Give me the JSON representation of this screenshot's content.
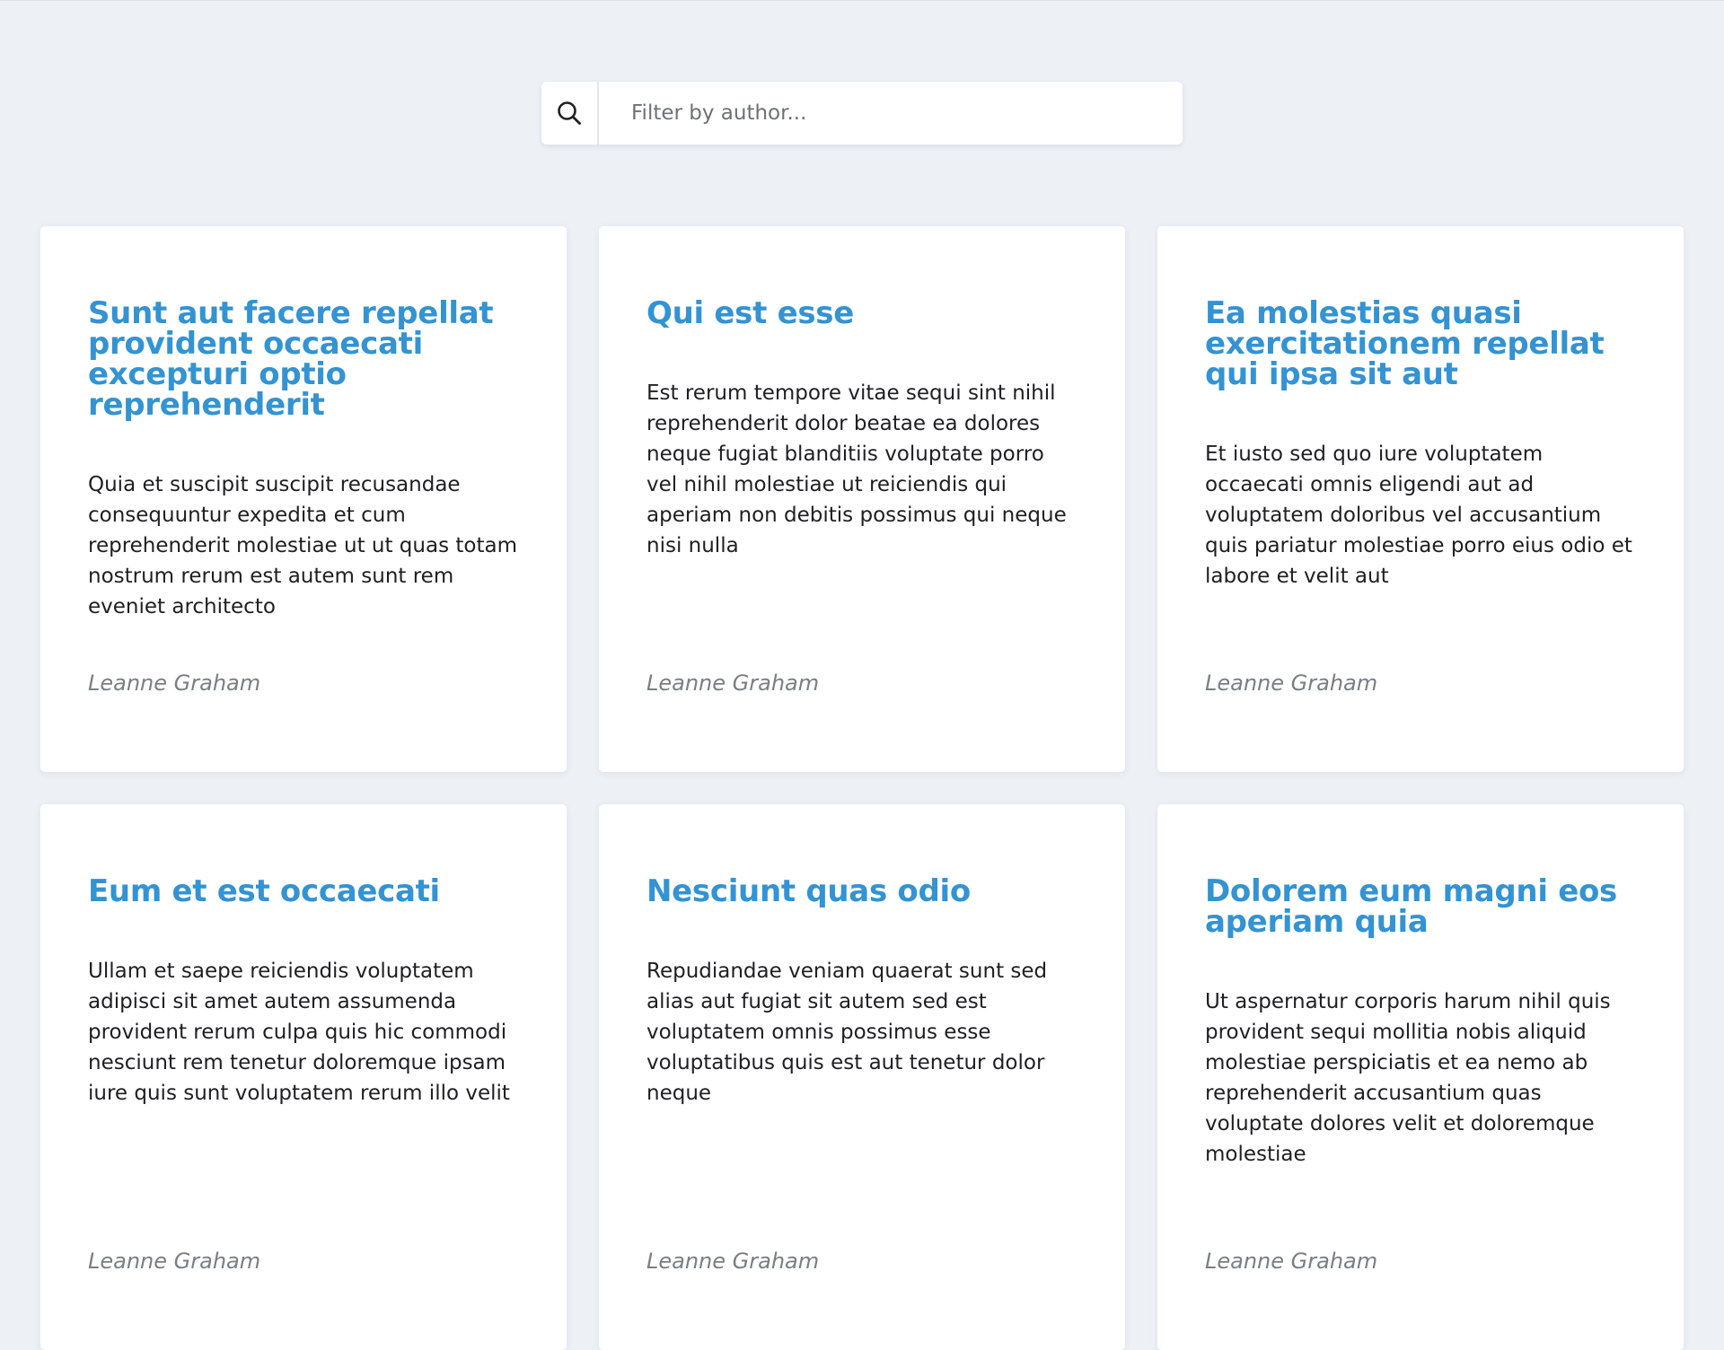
{
  "search": {
    "placeholder": "Filter by author...",
    "value": ""
  },
  "posts": [
    {
      "title": "Sunt aut facere repellat provident occaecati excepturi optio reprehenderit",
      "body": "Quia et suscipit suscipit recusandae consequuntur expedita et cum reprehenderit molestiae ut ut quas totam nostrum rerum est autem sunt rem eveniet architecto",
      "author": "Leanne Graham"
    },
    {
      "title": "Qui est esse",
      "body": "Est rerum tempore vitae sequi sint nihil reprehenderit dolor beatae ea dolores neque fugiat blanditiis voluptate porro vel nihil molestiae ut reiciendis qui aperiam non debitis possimus qui neque nisi nulla",
      "author": "Leanne Graham"
    },
    {
      "title": "Ea molestias quasi exercitationem repellat qui ipsa sit aut",
      "body": "Et iusto sed quo iure voluptatem occaecati omnis eligendi aut ad voluptatem doloribus vel accusantium quis pariatur molestiae porro eius odio et labore et velit aut",
      "author": "Leanne Graham"
    },
    {
      "title": "Eum et est occaecati",
      "body": "Ullam et saepe reiciendis voluptatem adipisci sit amet autem assumenda provident rerum culpa quis hic commodi nesciunt rem tenetur doloremque ipsam iure quis sunt voluptatem rerum illo velit",
      "author": "Leanne Graham"
    },
    {
      "title": "Nesciunt quas odio",
      "body": "Repudiandae veniam quaerat sunt sed alias aut fugiat sit autem sed est voluptatem omnis possimus esse voluptatibus quis est aut tenetur dolor neque",
      "author": "Leanne Graham"
    },
    {
      "title": "Dolorem eum magni eos aperiam quia",
      "body": "Ut aspernatur corporis harum nihil quis provident sequi mollitia nobis aliquid molestiae perspiciatis et ea nemo ab reprehenderit accusantium quas voluptate dolores velit et doloremque molestiae",
      "author": "Leanne Graham"
    }
  ],
  "colors": {
    "background": "#edf0f5",
    "title": "#3393d3",
    "body_text": "#1e1f22",
    "author_text": "#7a7e84"
  },
  "icons": {
    "search": "search-icon"
  }
}
